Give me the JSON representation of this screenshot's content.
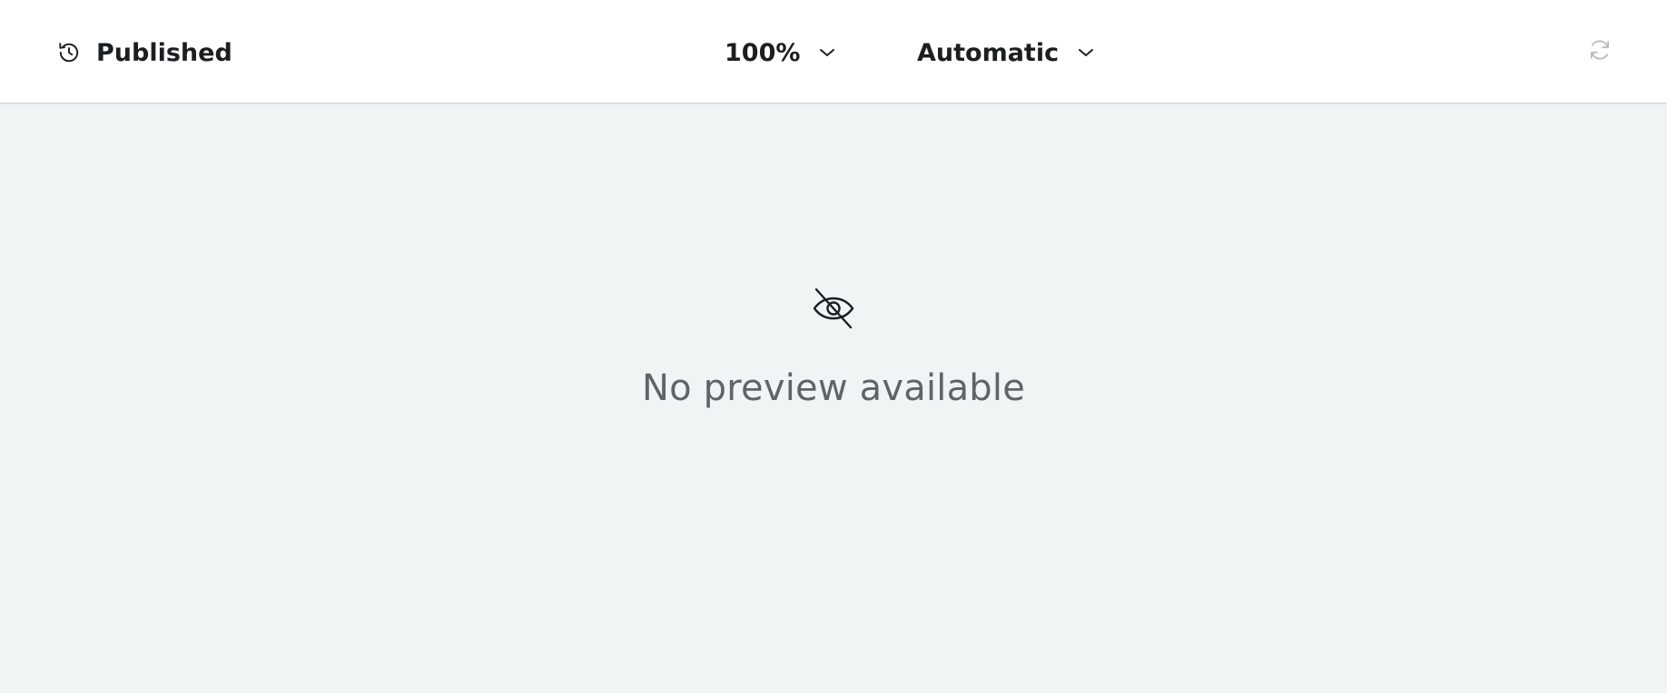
{
  "toolbar": {
    "version": {
      "label": "Published",
      "icon": "history-icon"
    },
    "zoom": {
      "value": "100%",
      "icon": "chevron-down-icon"
    },
    "device": {
      "value": "Automatic",
      "icon": "chevron-down-icon"
    },
    "refresh": {
      "icon": "refresh-icon",
      "color": "#b8bcc0"
    }
  },
  "preview": {
    "message": "No preview available",
    "icon": "eye-off-icon"
  },
  "colors": {
    "toolbar_bg": "#ffffff",
    "canvas_bg": "#f1f4f5",
    "text_primary": "#1c1f22",
    "text_muted": "#5f6469"
  }
}
